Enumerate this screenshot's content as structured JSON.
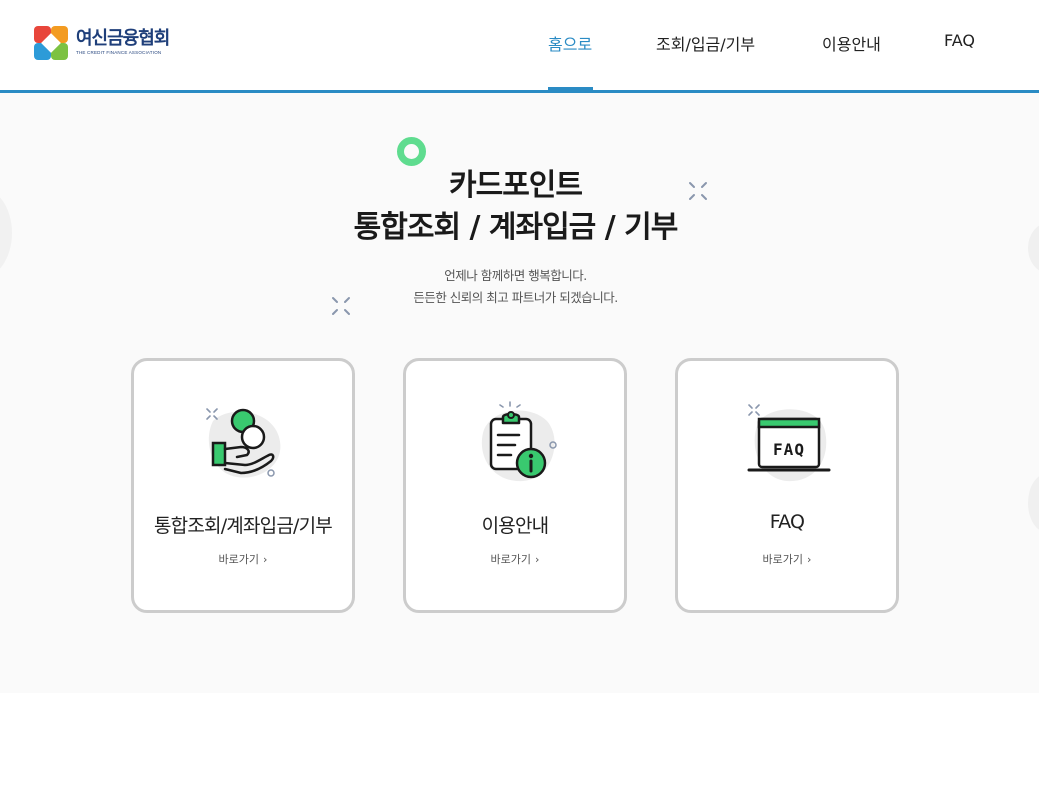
{
  "header": {
    "logo_ko": "여신금융협회",
    "logo_en": "THE CREDIT FINANCE ASSOCIATION",
    "nav": [
      {
        "label": "홈으로",
        "active": true
      },
      {
        "label": "조회/입금/기부",
        "active": false
      },
      {
        "label": "이용안내",
        "active": false
      },
      {
        "label": "FAQ",
        "active": false
      }
    ],
    "accent_color": "#2a8bc4"
  },
  "hero": {
    "title_line1": "카드포인트",
    "title_line2": "통합조회 / 계좌입금 / 기부",
    "subtitle_line1": "언제나 함께하면 행복합니다.",
    "subtitle_line2": "든든한 신뢰의 최고 파트너가 되겠습니다.",
    "decor_color": "#5fdc8f"
  },
  "cards": [
    {
      "title": "통합조회/계좌입금/기부",
      "link": "바로가기",
      "link_icon": "chevron-right-icon",
      "icon": "hand-coins-icon"
    },
    {
      "title": "이용안내",
      "link": "바로가기",
      "link_icon": "chevron-right-icon",
      "icon": "clipboard-info-icon"
    },
    {
      "title": "FAQ",
      "link": "바로가기",
      "link_icon": "chevron-right-icon",
      "icon": "faq-laptop-icon",
      "icon_text": "FAQ"
    }
  ]
}
